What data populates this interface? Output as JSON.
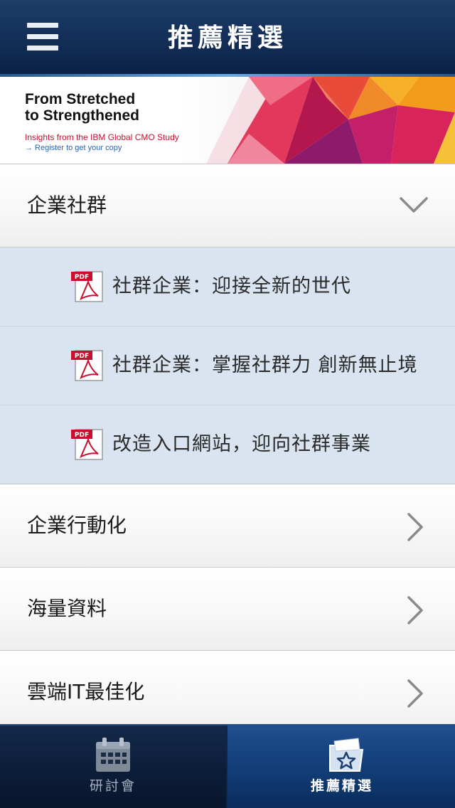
{
  "header": {
    "title": "推薦精選",
    "menu_icon": "hamburger-menu-icon"
  },
  "banner": {
    "headline_line1": "From Stretched",
    "headline_line2": "to Strengthened",
    "subtitle": "Insights from the IBM Global CMO Study",
    "link_text": "→ Register to get your copy",
    "accent_color": "#c41230",
    "link_color": "#2b65b0"
  },
  "categories": [
    {
      "label": "企業社群",
      "expanded": true,
      "chevron_icon": "chevron-down-icon",
      "documents": [
        {
          "label": "社群企業：迎接全新的世代",
          "icon": "pdf-file-icon",
          "icon_text": "PDF"
        },
        {
          "label": "社群企業：掌握社群力 創新無止境",
          "icon": "pdf-file-icon",
          "icon_text": "PDF"
        },
        {
          "label": "改造入口網站，迎向社群事業",
          "icon": "pdf-file-icon",
          "icon_text": "PDF"
        }
      ]
    },
    {
      "label": "企業行動化",
      "expanded": false,
      "chevron_icon": "chevron-right-icon"
    },
    {
      "label": "海量資料",
      "expanded": false,
      "chevron_icon": "chevron-right-icon"
    },
    {
      "label": "雲端IT最佳化",
      "expanded": false,
      "chevron_icon": "chevron-right-icon"
    }
  ],
  "tab_bar": {
    "tabs": [
      {
        "label": "研討會",
        "icon": "calendar-icon",
        "selected": false
      },
      {
        "label": "推薦精選",
        "icon": "star-folder-icon",
        "selected": true
      }
    ]
  },
  "colors": {
    "header_bg": "#14305a",
    "expanded_bg": "#d9e4f0",
    "tab_selected_bg": "#123e78",
    "tab_bg": "#0c1d38"
  }
}
